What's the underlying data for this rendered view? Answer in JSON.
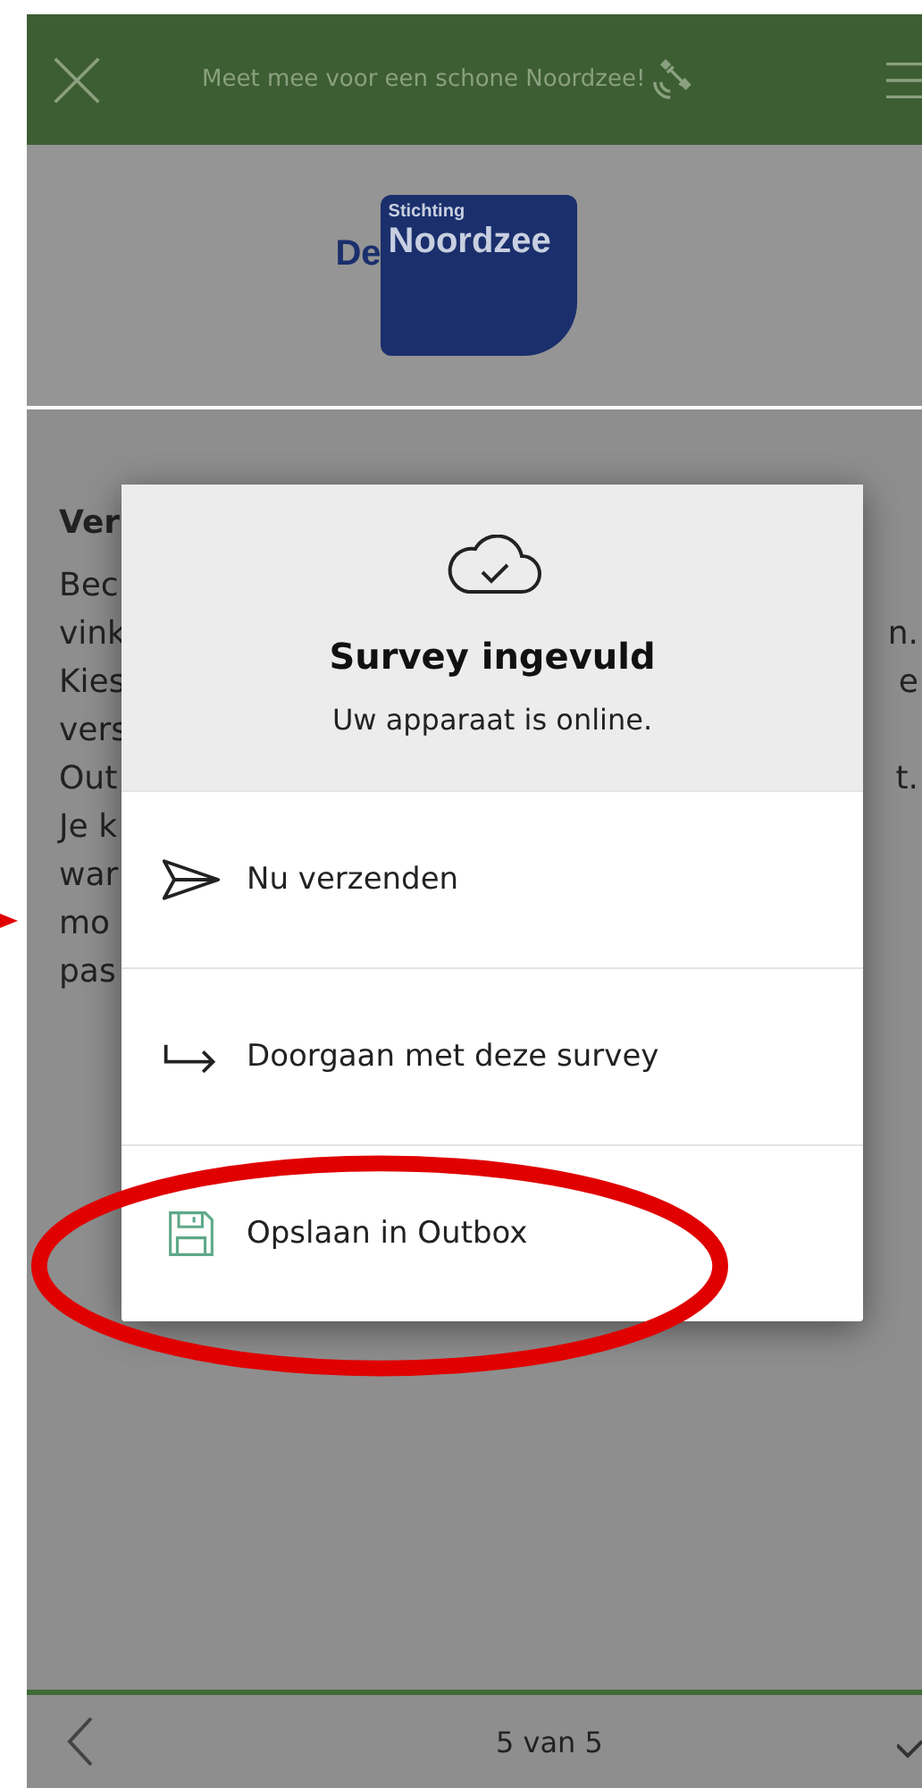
{
  "top_bar": {
    "title": "Meet mee voor een schone Noordzee!"
  },
  "logo": {
    "line_1": "Stichting",
    "line_2_left": "De",
    "line_2_right": "Noordzee"
  },
  "background_text": {
    "heading": "Ver",
    "lines": [
      {
        "left": "Bec"
      },
      {
        "left": "vink",
        "right": "n."
      },
      {
        "left": "Kies",
        "right": "e"
      },
      {
        "left": "vers"
      },
      {
        "left": "Out",
        "right": "t."
      },
      {
        "left": "Je k"
      },
      {
        "left": "war"
      },
      {
        "left": "mo"
      },
      {
        "left": "pas"
      }
    ]
  },
  "dialog": {
    "title": "Survey ingevuld",
    "subtitle": "Uw apparaat is online.",
    "options": [
      {
        "kind": "send",
        "label": "Nu verzenden"
      },
      {
        "kind": "continue",
        "label": "Doorgaan met deze survey"
      },
      {
        "kind": "save",
        "label": "Opslaan in Outbox"
      }
    ]
  },
  "bottom_bar": {
    "page": "5 van 5"
  }
}
